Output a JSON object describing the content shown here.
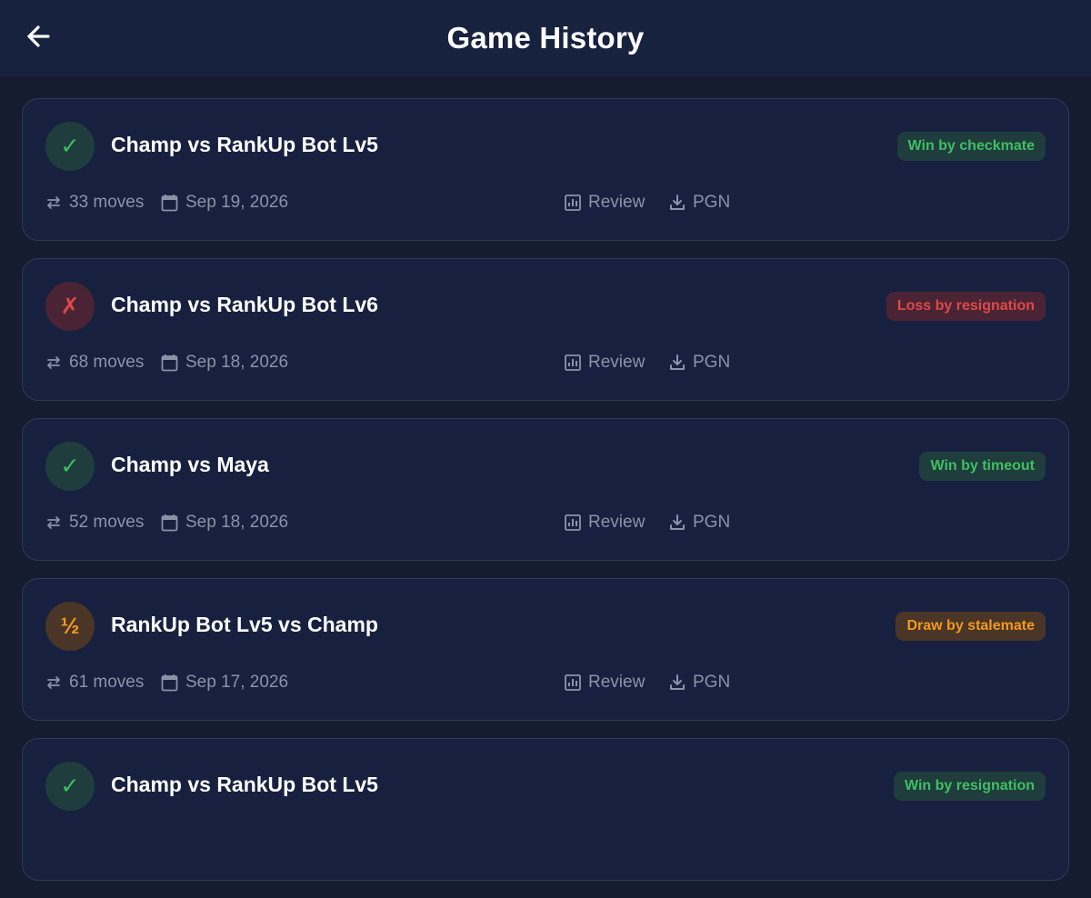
{
  "header": {
    "title": "Game History",
    "back_icon": "arrow-left-icon"
  },
  "actions": {
    "review_label": "Review",
    "pgn_label": "PGN"
  },
  "games": [
    {
      "result": "win",
      "status_glyph": "✓",
      "title": "Champ vs RankUp Bot Lv5",
      "badge": "Win by checkmate",
      "moves": "33 moves",
      "date": "Sep 19, 2026"
    },
    {
      "result": "loss",
      "status_glyph": "✗",
      "title": "Champ vs RankUp Bot Lv6",
      "badge": "Loss by resignation",
      "moves": "68 moves",
      "date": "Sep 18, 2026"
    },
    {
      "result": "win",
      "status_glyph": "✓",
      "title": "Champ vs Maya",
      "badge": "Win by timeout",
      "moves": "52 moves",
      "date": "Sep 18, 2026"
    },
    {
      "result": "draw",
      "status_glyph": "½",
      "title": "RankUp Bot Lv5 vs Champ",
      "badge": "Draw by stalemate",
      "moves": "61 moves",
      "date": "Sep 17, 2026"
    },
    {
      "result": "win",
      "status_glyph": "✓",
      "title": "Champ vs RankUp Bot Lv5",
      "badge": "Win by resignation",
      "moves": "",
      "date": ""
    }
  ],
  "colors": {
    "win": "#3fbf63",
    "loss": "#e04848",
    "draw": "#f29a1e",
    "background": "#151b30",
    "card": "#17213f"
  }
}
